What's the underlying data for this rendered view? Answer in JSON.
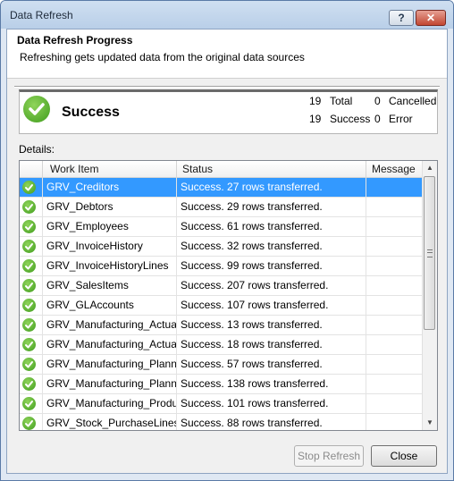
{
  "window": {
    "title": "Data Refresh"
  },
  "titlebar_buttons": {
    "help": "?",
    "close": "✕"
  },
  "header": {
    "title": "Data Refresh Progress",
    "subtitle": "Refreshing gets updated data from the original data sources"
  },
  "summary": {
    "status": "Success",
    "total_count": "19",
    "total_label": "Total",
    "success_count": "19",
    "success_label": "Success",
    "cancelled_count": "0",
    "cancelled_label": "Cancelled",
    "error_count": "0",
    "error_label": "Error"
  },
  "details_label": "Details:",
  "grid": {
    "columns": [
      "Work Item",
      "Status",
      "Message"
    ],
    "rows": [
      {
        "item": "GRV_Creditors",
        "status": "Success. 27 rows transferred.",
        "message": ""
      },
      {
        "item": "GRV_Debtors",
        "status": "Success. 29 rows transferred.",
        "message": ""
      },
      {
        "item": "GRV_Employees",
        "status": "Success. 61 rows transferred.",
        "message": ""
      },
      {
        "item": "GRV_InvoiceHistory",
        "status": "Success. 32 rows transferred.",
        "message": ""
      },
      {
        "item": "GRV_InvoiceHistoryLines",
        "status": "Success. 99 rows transferred.",
        "message": ""
      },
      {
        "item": "GRV_SalesItems",
        "status": "Success. 207 rows transferred.",
        "message": ""
      },
      {
        "item": "GRV_GLAccounts",
        "status": "Success. 107 rows transferred.",
        "message": ""
      },
      {
        "item": "GRV_Manufacturing_Actua...",
        "status": "Success. 13 rows transferred.",
        "message": ""
      },
      {
        "item": "GRV_Manufacturing_Actua...",
        "status": "Success. 18 rows transferred.",
        "message": ""
      },
      {
        "item": "GRV_Manufacturing_Plann...",
        "status": "Success. 57 rows transferred.",
        "message": ""
      },
      {
        "item": "GRV_Manufacturing_Plann...",
        "status": "Success. 138 rows transferred.",
        "message": ""
      },
      {
        "item": "GRV_Manufacturing_Produ...",
        "status": "Success. 101 rows transferred.",
        "message": ""
      },
      {
        "item": "GRV_Stock_PurchaseLines",
        "status": "Success. 88 rows transferred.",
        "message": ""
      }
    ],
    "selected_index": 0
  },
  "buttons": {
    "stop_refresh": "Stop Refresh",
    "close": "Close"
  },
  "colors": {
    "selection": "#3399ff",
    "success_green": "#3f9c1c"
  }
}
